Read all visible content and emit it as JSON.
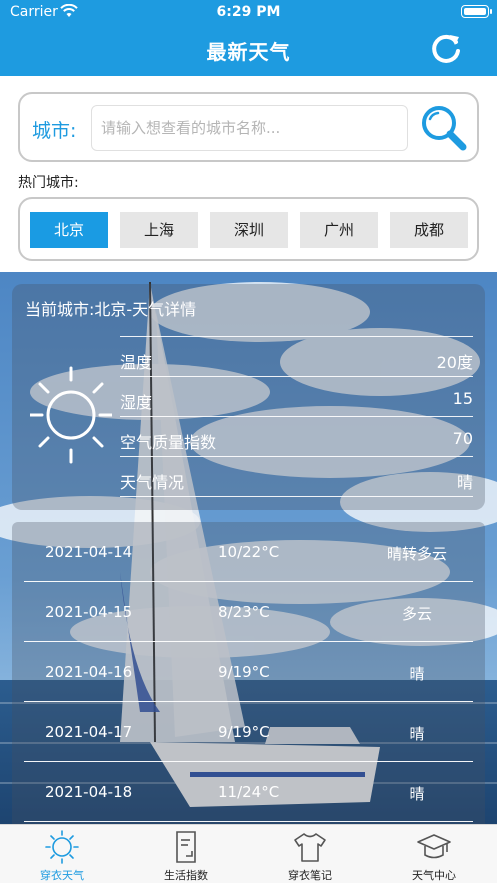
{
  "status_bar": {
    "carrier": "Carrier",
    "time": "6:29 PM"
  },
  "header": {
    "title": "最新天气",
    "refresh_icon": "refresh-icon"
  },
  "search": {
    "label": "城市:",
    "placeholder": "请输入想查看的城市名称...",
    "value": "",
    "button_icon": "search-icon"
  },
  "hot_cities": {
    "label": "热门城市:",
    "items": [
      {
        "label": "北京",
        "selected": true
      },
      {
        "label": "上海",
        "selected": false
      },
      {
        "label": "深圳",
        "selected": false
      },
      {
        "label": "广州",
        "selected": false
      },
      {
        "label": "成都",
        "selected": false
      }
    ]
  },
  "current": {
    "title": "当前城市:北京-天气详情",
    "icon": "sun-icon",
    "rows": [
      {
        "label": "温度",
        "value": "20度"
      },
      {
        "label": "湿度",
        "value": "15"
      },
      {
        "label": "空气质量指数",
        "value": "70"
      },
      {
        "label": "天气情况",
        "value": "晴"
      }
    ]
  },
  "forecast": [
    {
      "date": "2021-04-14",
      "temp": "10/22°C",
      "cond": "晴转多云"
    },
    {
      "date": "2021-04-15",
      "temp": "8/23°C",
      "cond": "多云"
    },
    {
      "date": "2021-04-16",
      "temp": "9/19°C",
      "cond": "晴"
    },
    {
      "date": "2021-04-17",
      "temp": "9/19°C",
      "cond": "晴"
    },
    {
      "date": "2021-04-18",
      "temp": "11/24°C",
      "cond": "晴"
    }
  ],
  "tabbar": {
    "items": [
      {
        "label": "穿衣天气",
        "icon": "sun-outline-icon",
        "active": true
      },
      {
        "label": "生活指数",
        "icon": "document-icon",
        "active": false
      },
      {
        "label": "穿衣笔记",
        "icon": "tshirt-icon",
        "active": false
      },
      {
        "label": "天气中心",
        "icon": "graduation-cap-icon",
        "active": false
      }
    ]
  },
  "colors": {
    "accent": "#1e9be0",
    "selected_city": "#1a9be3",
    "inactive_city": "#e6e6e6"
  }
}
